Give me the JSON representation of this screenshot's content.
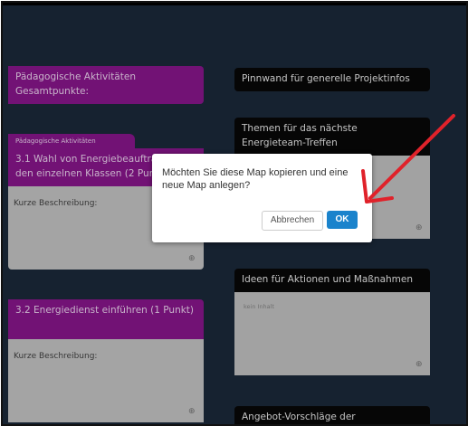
{
  "left_column": {
    "header_card": {
      "title": "Pädagogische Aktivitäten Gesamtpunkte:"
    },
    "card1": {
      "tag": "Pädagogische Aktivitäten",
      "title": "3.1 Wahl von Energiebeauftragten in den einzelnen Klassen (2 Punkte)",
      "description": "Kurze Beschreibung:"
    },
    "card2": {
      "title": "3.2 Energiedienst einführen (1 Punkt)",
      "description": "Kurze Beschreibung:"
    }
  },
  "right_column": {
    "pinnwand": {
      "title": "Pinnwand für generelle Projektinfos"
    },
    "themen": {
      "title": "Themen für das nächste Energieteam-Treffen"
    },
    "ideen": {
      "title": "Ideen für Aktionen und Maßnahmen",
      "content": "kein Inhalt"
    },
    "angebot": {
      "title": "Angebot-Vorschläge der"
    }
  },
  "dialog": {
    "message": "Möchten Sie diese Map kopieren und eine neue Map anlegen?",
    "cancel_label": "Abbrechen",
    "ok_label": "OK"
  },
  "colors": {
    "background": "#1b2a3b",
    "purple": "#8b168f",
    "ok_button": "#1a83cc",
    "arrow": "#e0222a"
  }
}
